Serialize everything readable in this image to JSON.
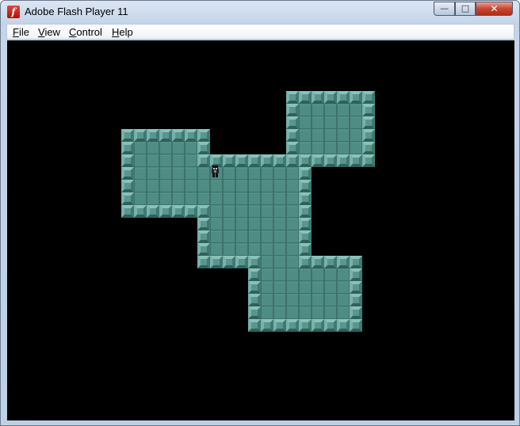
{
  "window": {
    "title": "Adobe Flash Player 11",
    "icon": "flash-icon",
    "controls": {
      "minimize_icon": "minimize-icon",
      "maximize_icon": "maximize-icon",
      "close_icon": "close-icon"
    }
  },
  "menu": {
    "items": [
      {
        "label": "File"
      },
      {
        "label": "View"
      },
      {
        "label": "Control"
      },
      {
        "label": "Help"
      }
    ]
  },
  "game": {
    "background": "#000000",
    "floor_color": "#4e8c84",
    "wall_color": "#5f9f97",
    "player_sprite": "player-character-icon"
  }
}
